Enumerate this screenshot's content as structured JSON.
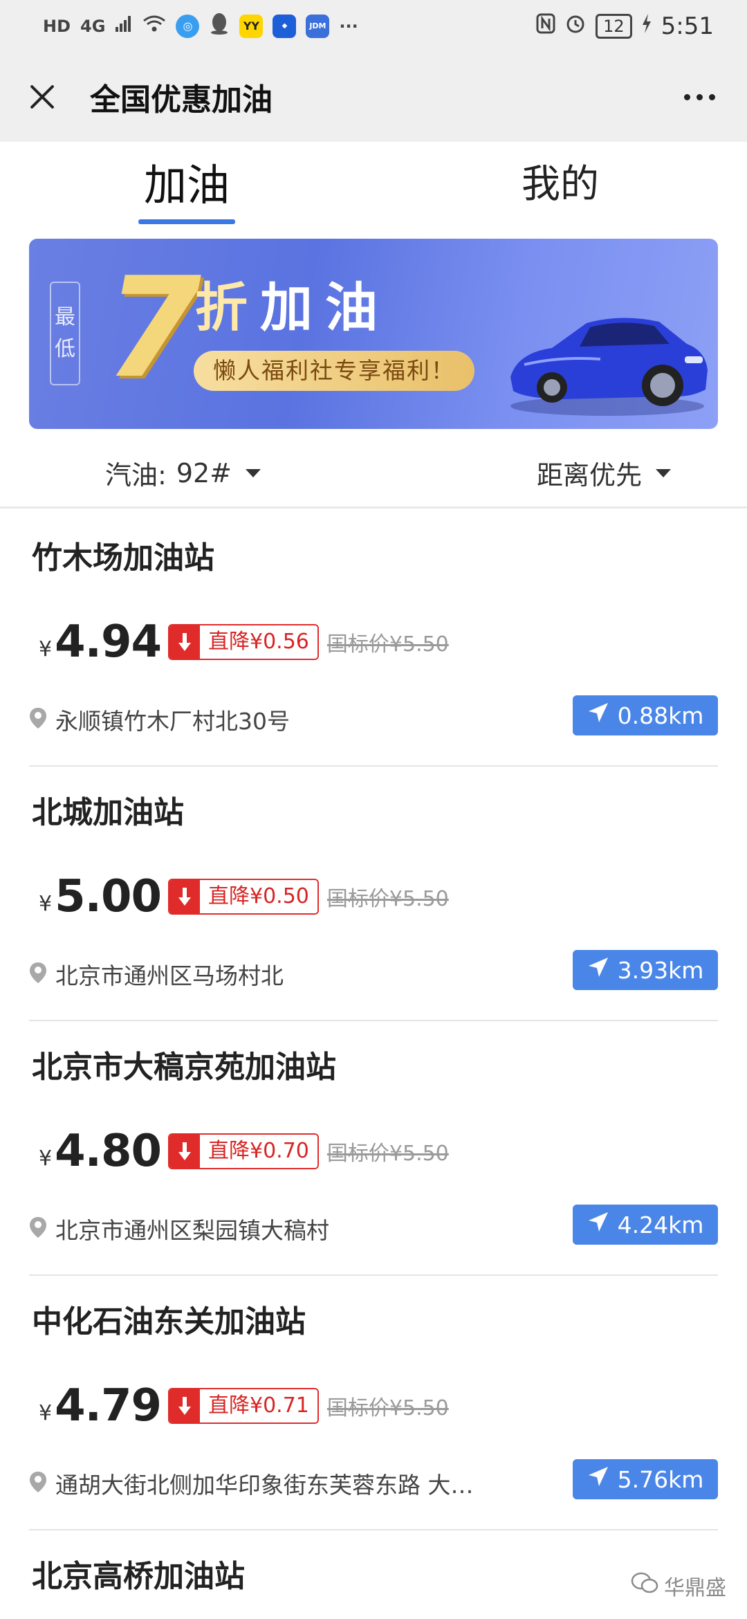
{
  "status_bar": {
    "left_text": "HD",
    "network": "4G",
    "app_icon_yy": "YY",
    "app_icon_jdm": "JDM",
    "more": "···",
    "battery": "12",
    "time": "5:51"
  },
  "title_bar": {
    "title": "全国优惠加油"
  },
  "tabs": [
    {
      "label": "加油",
      "active": true
    },
    {
      "label": "我的",
      "active": false
    }
  ],
  "banner": {
    "tag": "最低",
    "tag_chars": [
      "最",
      "低"
    ],
    "number": "7",
    "zhe": "折",
    "headline": "加油",
    "subtitle": "懒人福利社专享福利！"
  },
  "filters": {
    "fuel_label": "汽油:",
    "fuel_value": "92#",
    "sort_label": "距离优先"
  },
  "stations": [
    {
      "name": "竹木场加油站",
      "price": "4.94",
      "drop": "直降¥0.56",
      "std": "国标价¥5.50",
      "address": "永顺镇竹木厂村北30号",
      "distance": "0.88km"
    },
    {
      "name": "北城加油站",
      "price": "5.00",
      "drop": "直降¥0.50",
      "std": "国标价¥5.50",
      "address": "北京市通州区马场村北",
      "distance": "3.93km"
    },
    {
      "name": "北京市大稿京苑加油站",
      "price": "4.80",
      "drop": "直降¥0.70",
      "std": "国标价¥5.50",
      "address": "北京市通州区梨园镇大稿村",
      "distance": "4.24km"
    },
    {
      "name": "中化石油东关加油站",
      "price": "4.79",
      "drop": "直降¥0.71",
      "std": "国标价¥5.50",
      "address": "通胡大街北侧加华印象街东芙蓉东路 大顺...",
      "distance": "5.76km"
    },
    {
      "name": "北京高桥加油站"
    }
  ],
  "currency": "¥",
  "watermark": "华鼎盛",
  "colors": {
    "accent_blue": "#4a86e8",
    "drop_red": "#e02b2b",
    "tab_underline": "#3a78e4"
  }
}
